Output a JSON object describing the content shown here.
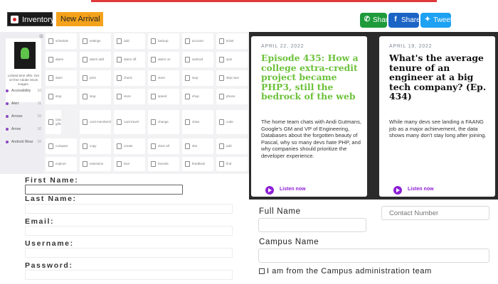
{
  "tabs": {
    "inventory": "Inventory",
    "new_arrival": "New Arrival"
  },
  "share": {
    "whatsapp": "Share",
    "facebook": "Share 0",
    "twitter": "Tweet"
  },
  "dashboard": {
    "blurb": "Limited time offer. Get 10 free Adobe Stock images.",
    "sidebar": [
      {
        "label": "Accessibility",
        "count": "10"
      },
      {
        "label": "Alert",
        "count": "11"
      },
      {
        "label": "Arrows",
        "count": "10"
      },
      {
        "label": "Arrow",
        "count": "10"
      },
      {
        "label": "Android Wear",
        "count": "10"
      }
    ],
    "cells": [
      "schedule",
      "settings",
      "add",
      "backup",
      "account",
      "ticket",
      "alarm",
      "alarm add",
      "alarm off",
      "alarm on",
      "android",
      "spin",
      "stars",
      "print",
      "check",
      "store",
      "stop",
      "skip next",
      "stop",
      "stop",
      "store",
      "speed",
      "shop",
      "phone",
      "card giftcard",
      "card membership",
      "card travel",
      "change",
      "class",
      "code",
      "compare",
      "copy",
      "create",
      "done all",
      "dns",
      "add",
      "explore",
      "extension",
      "face",
      "favorite",
      "feedback",
      "find"
    ]
  },
  "podcast": {
    "cards": [
      {
        "date": "APRIL 22, 2022",
        "title": "Episode 435: How a college extra-credit project became PHP3, still the bedrock of the web",
        "description": "The home team chats with Andi Gutmans, Google's GM and VP of Engineering, Databases about the forgotten beauty of Pascal, why so many devs hate PHP, and why companies should prioritize the developer experience.",
        "listen": "Listen now"
      },
      {
        "date": "APRIL 19, 2022",
        "title": "What's the average tenure of an engineer at a big tech company? (Ep. 434)",
        "description": "While many devs see landing a FAANG job as a major achievement, the data shows many don't stay long after joining.",
        "listen": "Listen now"
      }
    ]
  },
  "signup": {
    "first_name": "First Name:",
    "last_name": "Last Name:",
    "email": "Email:",
    "username": "Username:",
    "password": "Password:"
  },
  "campus": {
    "full_name": "Full Name",
    "contact_placeholder": "Contact Number",
    "campus_name": "Campus Name",
    "admin_check": "I am from the Campus administration team"
  }
}
